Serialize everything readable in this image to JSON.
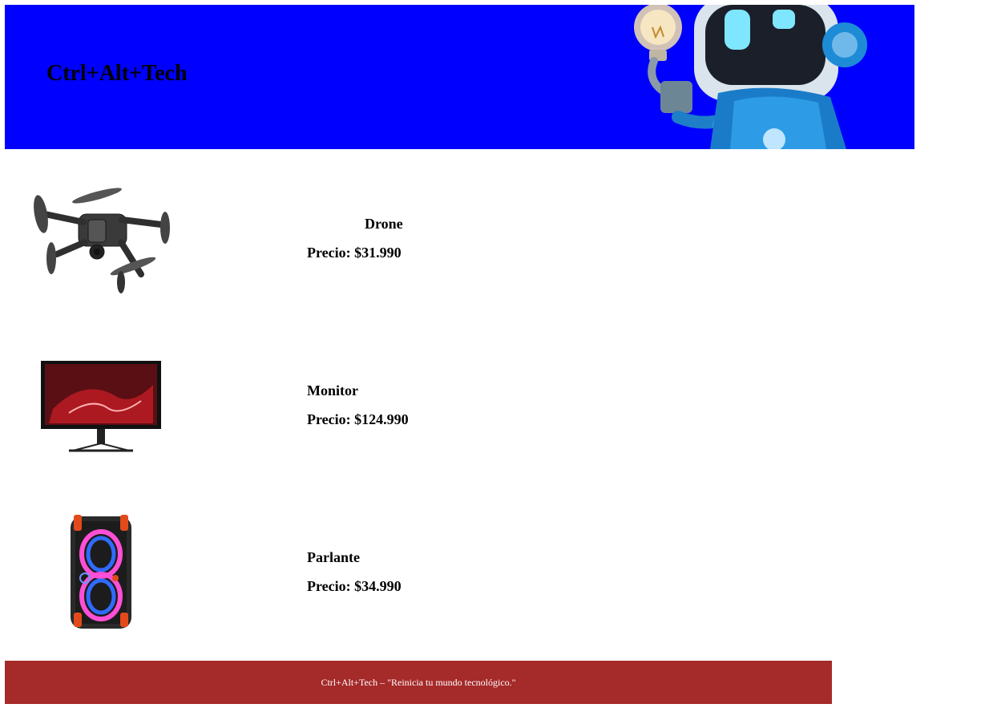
{
  "header": {
    "brand": "Ctrl+Alt+Tech",
    "background_color": "#0000ff",
    "hero_image": "robot-holding-lightbulb"
  },
  "products": [
    {
      "name": "Drone",
      "price": "Precio: $31.990",
      "image": "drone-image"
    },
    {
      "name": "Monitor",
      "price": "Precio: $124.990",
      "image": "monitor-image"
    },
    {
      "name": "Parlante",
      "price": "Precio: $34.990",
      "image": "speaker-image"
    }
  ],
  "footer": {
    "text": "Ctrl+Alt+Tech – \"Reinicia tu mundo tecnológico.\"",
    "background_color": "#a52a2a"
  }
}
